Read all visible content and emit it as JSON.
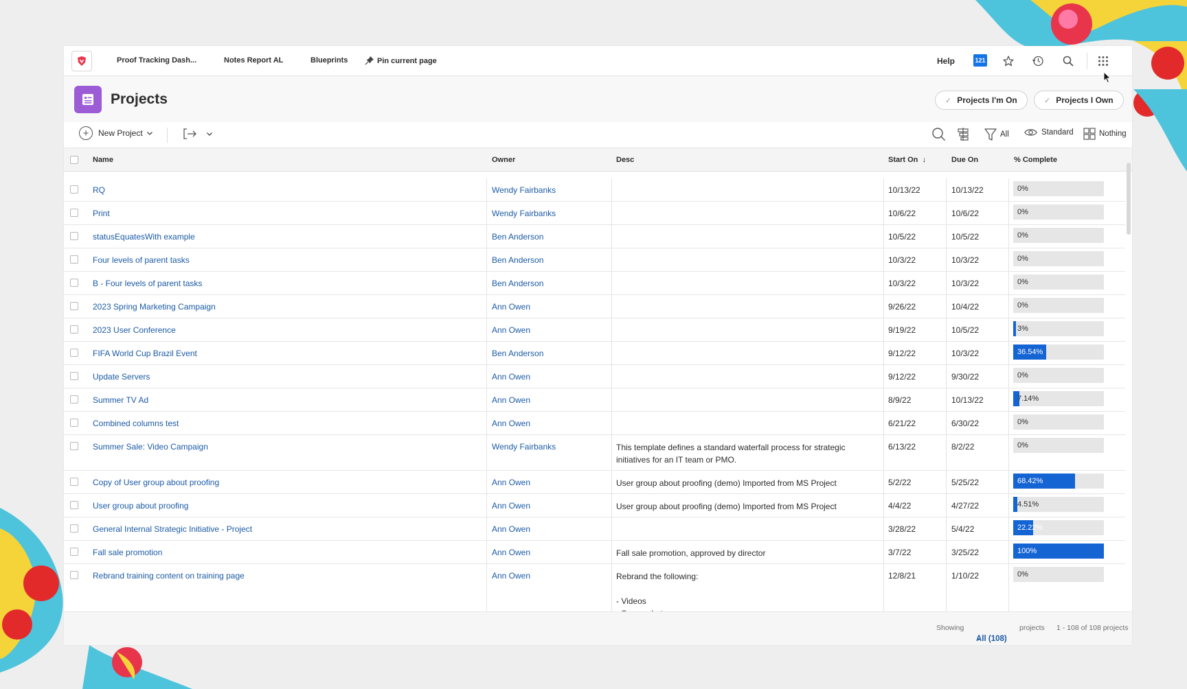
{
  "topnav": {
    "links": [
      "Proof Tracking Dash...",
      "Notes Report AL",
      "Blueprints",
      "Pin current page"
    ],
    "help": "Help",
    "notification_count": "121",
    "icons": [
      "star-icon",
      "history-icon",
      "search-icon",
      "app-grid-icon"
    ]
  },
  "header": {
    "title": "Projects",
    "filter_pills": [
      "Projects I'm On",
      "Projects I Own"
    ]
  },
  "toolbar": {
    "new_project": "New Project",
    "filter": "All",
    "view": "Standard",
    "grouping": "Nothing"
  },
  "table": {
    "columns": [
      "Name",
      "Owner",
      "Desc",
      "Start On",
      "Due On",
      "% Complete"
    ],
    "sort_indicator": "↓",
    "rows": [
      {
        "name": "RQ",
        "owner": "Wendy Fairbanks",
        "desc": "",
        "start": "10/13/22",
        "due": "10/13/22",
        "complete": "0%",
        "pct": 0
      },
      {
        "name": "Print",
        "owner": "Wendy Fairbanks",
        "desc": "",
        "start": "10/6/22",
        "due": "10/6/22",
        "complete": "0%",
        "pct": 0
      },
      {
        "name": "statusEquatesWith example",
        "owner": "Ben Anderson",
        "desc": "",
        "start": "10/5/22",
        "due": "10/5/22",
        "complete": "0%",
        "pct": 0
      },
      {
        "name": "Four levels of parent tasks",
        "owner": "Ben Anderson",
        "desc": "",
        "start": "10/3/22",
        "due": "10/3/22",
        "complete": "0%",
        "pct": 0
      },
      {
        "name": "B - Four levels of parent tasks",
        "owner": "Ben Anderson",
        "desc": "",
        "start": "10/3/22",
        "due": "10/3/22",
        "complete": "0%",
        "pct": 0
      },
      {
        "name": "2023 Spring Marketing Campaign",
        "owner": "Ann Owen",
        "desc": "",
        "start": "9/26/22",
        "due": "10/4/22",
        "complete": "0%",
        "pct": 0
      },
      {
        "name": "2023 User Conference",
        "owner": "Ann Owen",
        "desc": "",
        "start": "9/19/22",
        "due": "10/5/22",
        "complete": "3%",
        "pct": 3
      },
      {
        "name": "FIFA World Cup Brazil Event",
        "owner": "Ben Anderson",
        "desc": "",
        "start": "9/12/22",
        "due": "10/3/22",
        "complete": "36.54%",
        "pct": 36.54
      },
      {
        "name": "Update Servers",
        "owner": "Ann Owen",
        "desc": "",
        "start": "9/12/22",
        "due": "9/30/22",
        "complete": "0%",
        "pct": 0
      },
      {
        "name": "Summer TV Ad",
        "owner": "Ann Owen",
        "desc": "",
        "start": "8/9/22",
        "due": "10/13/22",
        "complete": "7.14%",
        "pct": 7.14
      },
      {
        "name": "Combined columns test",
        "owner": "Ann Owen",
        "desc": "",
        "start": "6/21/22",
        "due": "6/30/22",
        "complete": "0%",
        "pct": 0
      },
      {
        "name": "Summer Sale: Video Campaign",
        "owner": "Wendy Fairbanks",
        "desc": "This template defines a standard waterfall process for strategic initiatives for an IT team or PMO.",
        "start": "6/13/22",
        "due": "8/2/22",
        "complete": "0%",
        "pct": 0
      },
      {
        "name": "Copy of User group about proofing",
        "owner": "Ann Owen",
        "desc": "User group about proofing (demo) Imported from MS Project",
        "start": "5/2/22",
        "due": "5/25/22",
        "complete": "68.42%",
        "pct": 68.42
      },
      {
        "name": "User group about proofing",
        "owner": "Ann Owen",
        "desc": "User group about proofing (demo) Imported from MS Project",
        "start": "4/4/22",
        "due": "4/27/22",
        "complete": "4.51%",
        "pct": 4.51
      },
      {
        "name": "General Internal Strategic Initiative - Project",
        "owner": "Ann Owen",
        "desc": "",
        "start": "3/28/22",
        "due": "5/4/22",
        "complete": "22.22%",
        "pct": 22.22
      },
      {
        "name": "Fall sale promotion",
        "owner": "Ann Owen",
        "desc": "Fall sale promotion, approved by director",
        "start": "3/7/22",
        "due": "3/25/22",
        "complete": "100%",
        "pct": 100
      },
      {
        "name": "Rebrand training content on training page",
        "owner": "Ann Owen",
        "desc": "Rebrand the following:\n\n- Videos\n- Screenshots\n- Guides",
        "start": "12/8/21",
        "due": "1/10/22",
        "complete": "0%",
        "pct": 0
      }
    ]
  },
  "footer": {
    "showing_label": "Showing",
    "page_size": "All (108)",
    "unit": "projects",
    "range": "1 - 108 of 108 projects"
  },
  "colors": {
    "accent": "#1473e6",
    "progress": "#1564d4",
    "link": "#1b5aa6",
    "project_icon": "#9b5cd6"
  }
}
